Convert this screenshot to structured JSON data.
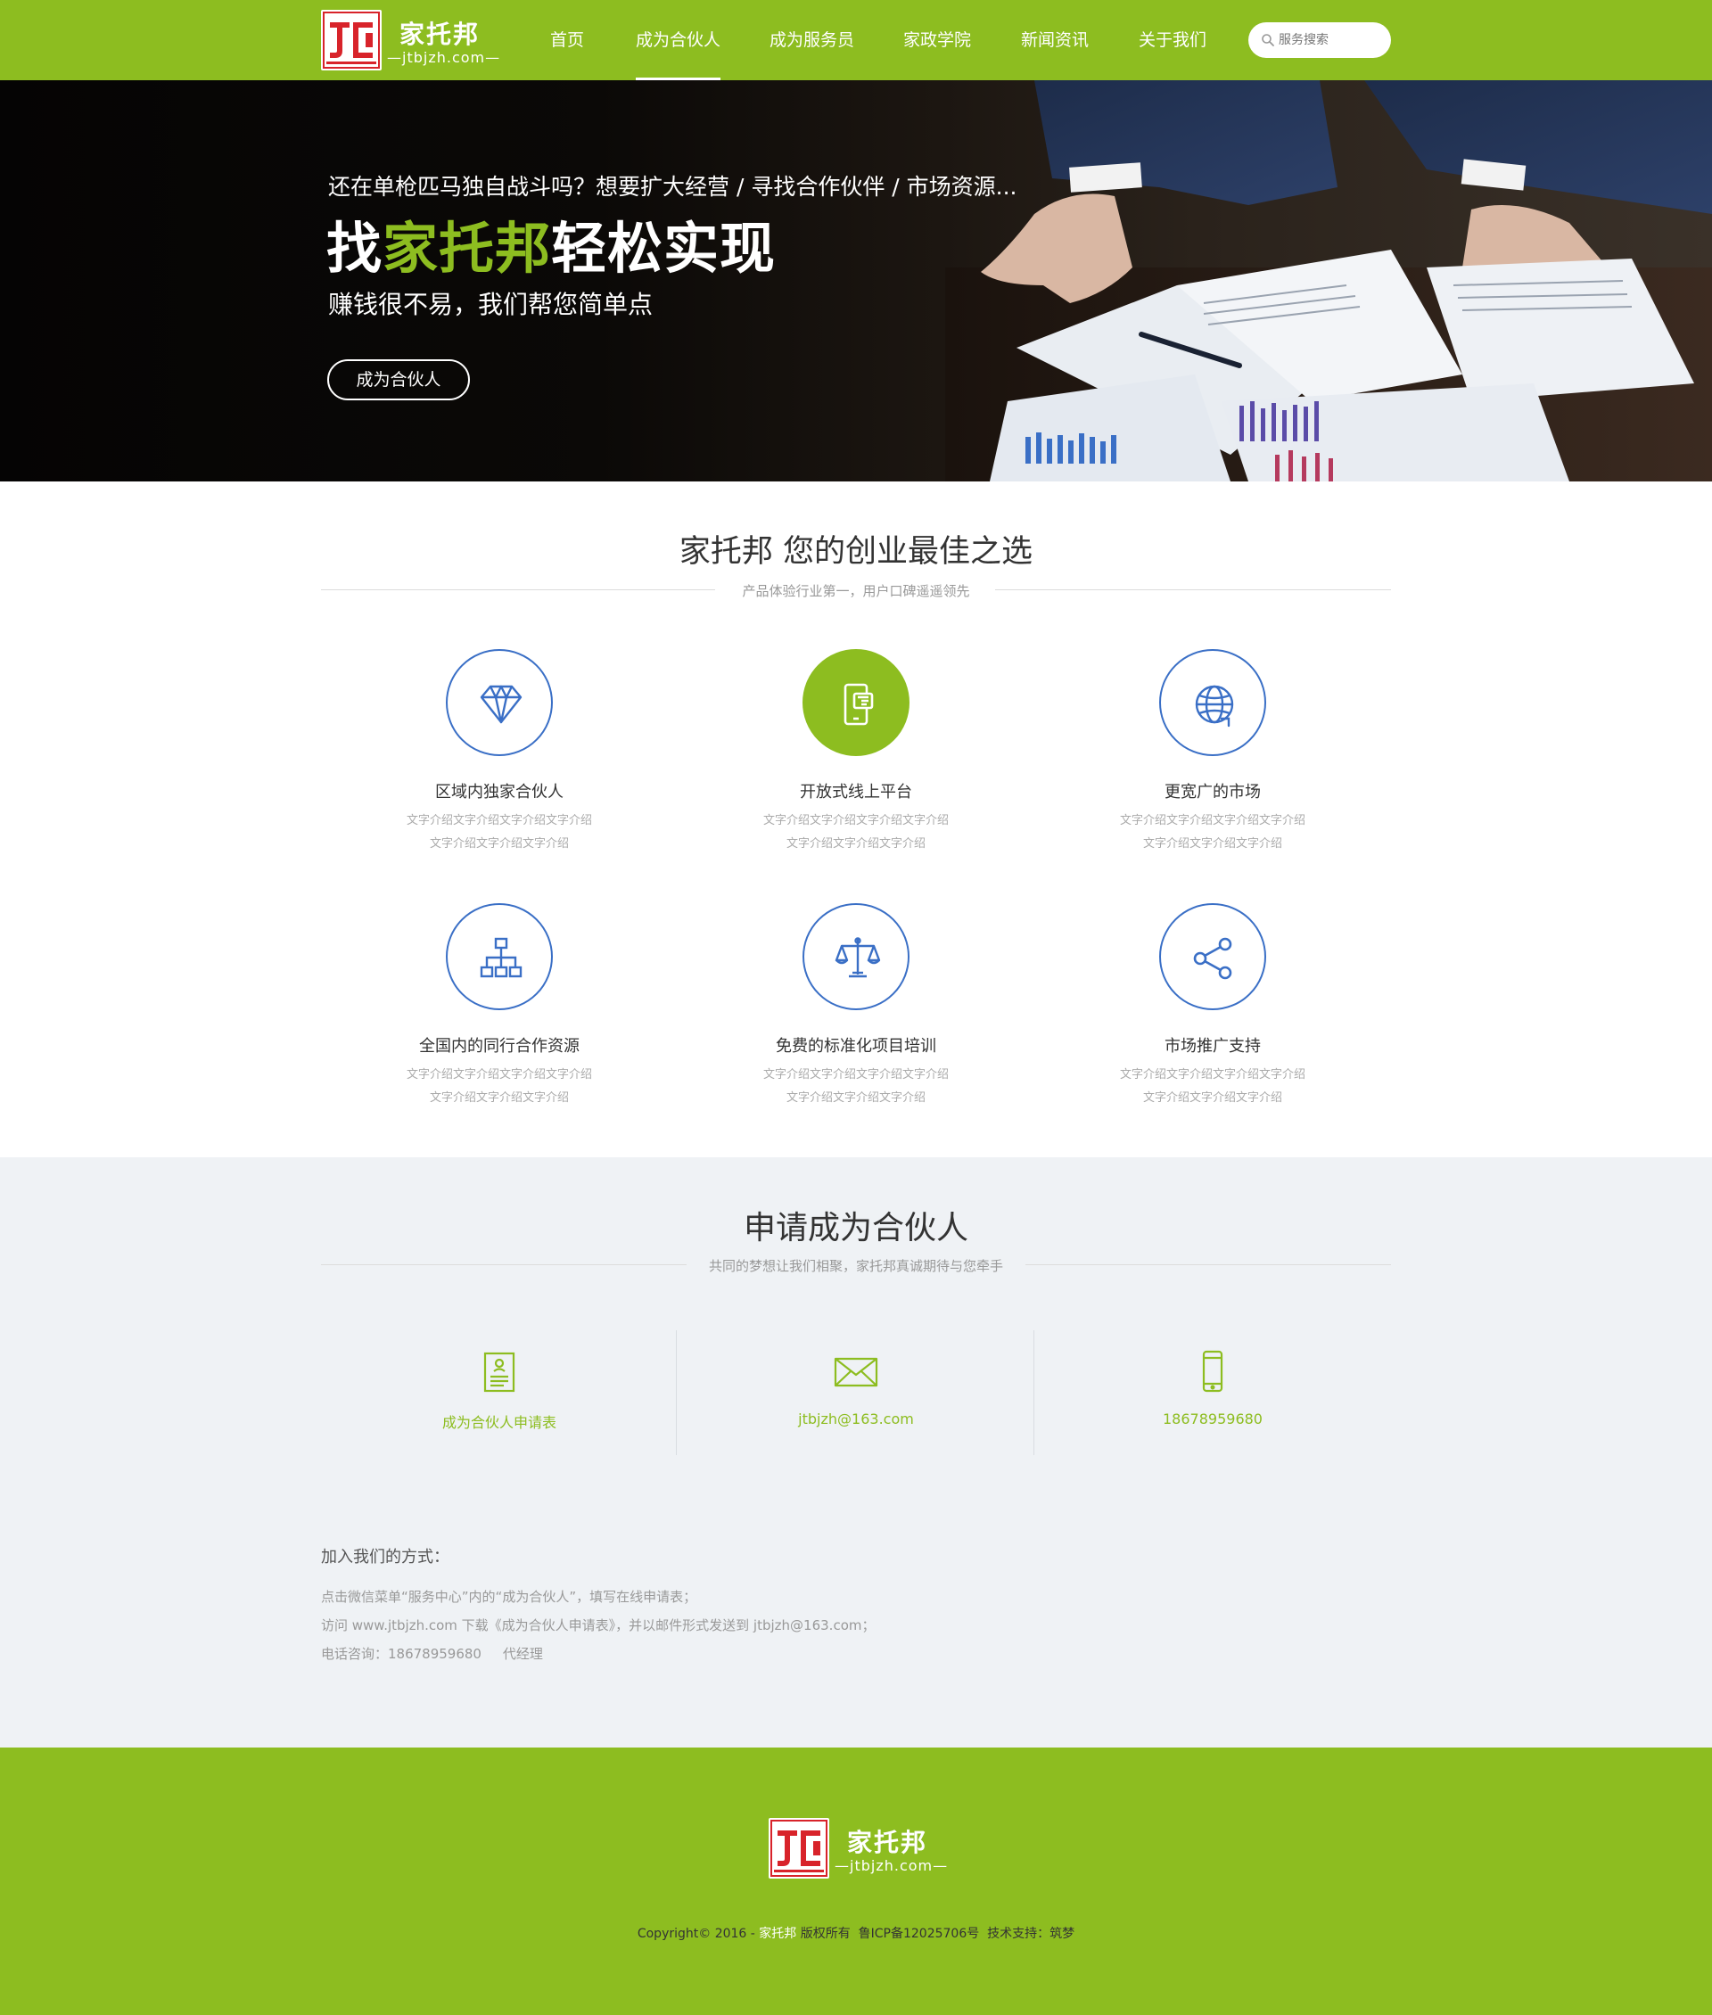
{
  "header": {
    "brand_name": "家托邦",
    "brand_domain": "—jtbjzh.com—",
    "nav": [
      {
        "label": "首页",
        "active": false
      },
      {
        "label": "成为合伙人",
        "active": true
      },
      {
        "label": "成为服务员",
        "active": false
      },
      {
        "label": "家政学院",
        "active": false
      },
      {
        "label": "新闻资讯",
        "active": false
      },
      {
        "label": "关于我们",
        "active": false
      }
    ],
    "search_placeholder": "服务搜索"
  },
  "banner": {
    "line1": "还在单枪匹马独自战斗吗？想要扩大经营 / 寻找合作伙伴 / 市场资源...",
    "line2_prefix": "找",
    "line2_highlight": "家托邦",
    "line2_suffix": "轻松实现",
    "line3": "赚钱很不易，我们帮您简单点",
    "button": "成为合伙人"
  },
  "features_section": {
    "title": "家托邦 您的创业最佳之选",
    "subtitle": "产品体验行业第一，用户口碑遥遥领先",
    "items": [
      {
        "icon": "diamond-icon",
        "title": "区域内独家合伙人",
        "desc1": "文字介绍文字介绍文字介绍文字介绍",
        "desc2": "文字介绍文字介绍文字介绍"
      },
      {
        "icon": "mobile-platform-icon",
        "title": "开放式线上平台",
        "desc1": "文字介绍文字介绍文字介绍文字介绍",
        "desc2": "文字介绍文字介绍文字介绍"
      },
      {
        "icon": "globe-icon",
        "title": "更宽广的市场",
        "desc1": "文字介绍文字介绍文字介绍文字介绍",
        "desc2": "文字介绍文字介绍文字介绍"
      },
      {
        "icon": "org-chart-icon",
        "title": "全国内的同行合作资源",
        "desc1": "文字介绍文字介绍文字介绍文字介绍",
        "desc2": "文字介绍文字介绍文字介绍"
      },
      {
        "icon": "scales-icon",
        "title": "免费的标准化项目培训",
        "desc1": "文字介绍文字介绍文字介绍文字介绍",
        "desc2": "文字介绍文字介绍文字介绍"
      },
      {
        "icon": "share-icon",
        "title": "市场推广支持",
        "desc1": "文字介绍文字介绍文字介绍文字介绍",
        "desc2": "文字介绍文字介绍文字介绍"
      }
    ]
  },
  "apply_section": {
    "title": "申请成为合伙人",
    "subtitle": "共同的梦想让我们相聚，家托邦真诚期待与您牵手",
    "contacts": [
      {
        "icon": "application-form-icon",
        "text": "成为合伙人申请表"
      },
      {
        "icon": "envelope-icon",
        "text": "jtbjzh@163.com"
      },
      {
        "icon": "phone-icon",
        "text": "18678959680"
      }
    ],
    "join_title": "加入我们的方式：",
    "join_lines": [
      "点击微信菜单“服务中心”内的“成为合伙人”，填写在线申请表；",
      "访问 www.jtbjzh.com 下载《成为合伙人申请表》，并以邮件形式发送到 jtbjzh@163.com；",
      "电话咨询：18678959680     代经理"
    ]
  },
  "footer": {
    "brand_name": "家托邦",
    "brand_domain": "—jtbjzh.com—",
    "copyright_prefix": "Copyright© 2016 - ",
    "copyright_brand": "家托邦",
    "copyright_suffix": " 版权所有  鲁ICP备12025706号  技术支持：筑梦"
  },
  "colors": {
    "brand_green": "#8dbd20",
    "icon_blue": "#3a6fc6",
    "apply_bg": "#eff2f5",
    "logo_red": "#d8232a"
  }
}
